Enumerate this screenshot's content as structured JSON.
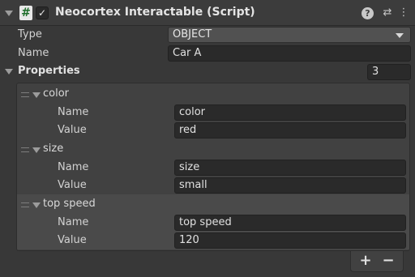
{
  "header": {
    "title": "Neocortex Interactable (Script)",
    "script_glyph": "#",
    "enabled_glyph": "✓",
    "enabled": true,
    "icons": [
      "help-icon",
      "preset-icon",
      "kebab-menu-icon"
    ],
    "help_glyph": "?",
    "preset_glyph": "⇄",
    "menu_glyph": "⋮"
  },
  "fields": {
    "type_label": "Type",
    "type_value": "OBJECT",
    "name_label": "Name",
    "name_value": "Car A"
  },
  "properties": {
    "label": "Properties",
    "count": "3",
    "items": [
      {
        "key": "color",
        "name_label": "Name",
        "name_value": "color",
        "value_label": "Value",
        "value_value": "red"
      },
      {
        "key": "size",
        "name_label": "Name",
        "name_value": "size",
        "value_label": "Value",
        "value_value": "small"
      },
      {
        "key": "top speed",
        "name_label": "Name",
        "name_value": "top speed",
        "value_label": "Value",
        "value_value": "120"
      }
    ]
  },
  "footer": {
    "add_glyph": "+",
    "remove_glyph": "−"
  },
  "colors": {
    "background": "#383838",
    "field": "#2a2a2a",
    "dropdown": "#515151",
    "list_bg": "#414141",
    "text": "#d2d2d2"
  }
}
